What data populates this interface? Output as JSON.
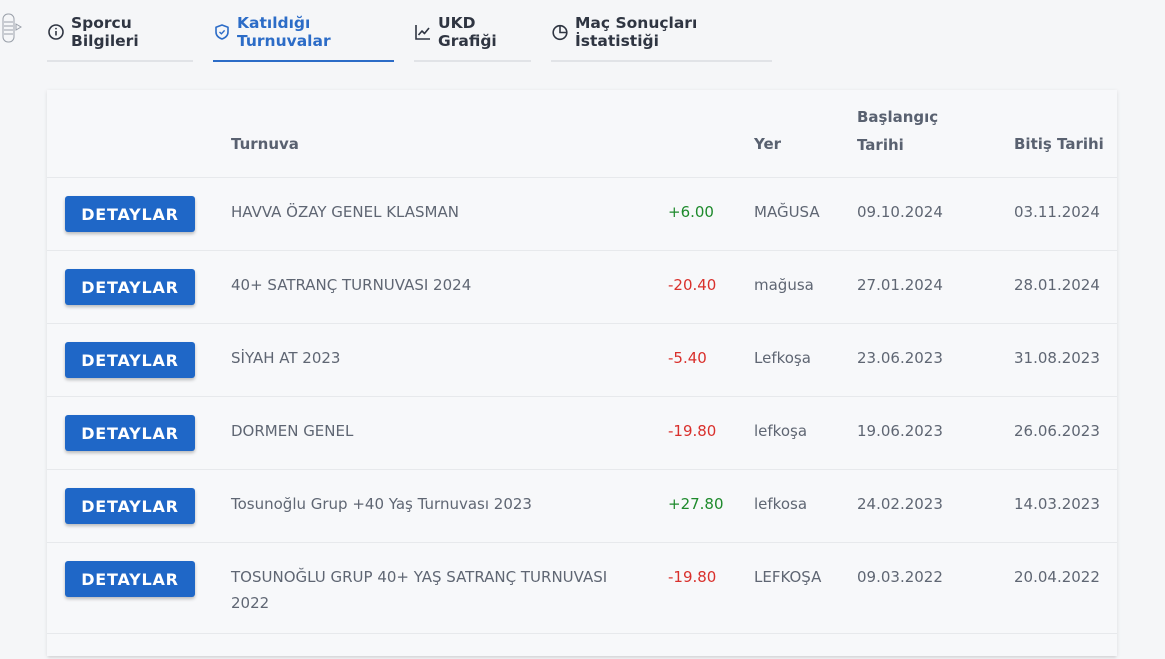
{
  "tabs": [
    {
      "label": "Sporcu Bilgileri",
      "icon": "info-circle-icon",
      "active": false
    },
    {
      "label": "Katıldığı Turnuvalar",
      "icon": "shield-icon",
      "active": true
    },
    {
      "label": "UKD Grafiği",
      "icon": "line-chart-icon",
      "active": false
    },
    {
      "label": "Maç Sonuçları İstatistiği",
      "icon": "pie-chart-icon",
      "active": false
    }
  ],
  "table": {
    "headers": {
      "turnuva": "Turnuva",
      "yer": "Yer",
      "baslangic_line1": "Başlangıç",
      "baslangic_line2": "Tarihi",
      "bitis": "Bitiş Tarihi"
    },
    "button_label": "DETAYLAR",
    "rows": [
      {
        "name": "HAVVA ÖZAY GENEL KLASMAN",
        "delta": "+6.00",
        "yer": "MAĞUSA",
        "baslangic": "09.10.2024",
        "bitis": "03.11.2024"
      },
      {
        "name": "40+ SATRANÇ TURNUVASI 2024",
        "delta": "-20.40",
        "yer": "mağusa",
        "baslangic": "27.01.2024",
        "bitis": "28.01.2024"
      },
      {
        "name": "SİYAH AT 2023",
        "delta": "-5.40",
        "yer": "Lefkoşa",
        "baslangic": "23.06.2023",
        "bitis": "31.08.2023"
      },
      {
        "name": "DORMEN GENEL",
        "delta": "-19.80",
        "yer": "lefkoşa",
        "baslangic": "19.06.2023",
        "bitis": "26.06.2023"
      },
      {
        "name": "Tosunoğlu Grup +40 Yaş Turnuvası 2023",
        "delta": "+27.80",
        "yer": "lefkosa",
        "baslangic": "24.02.2023",
        "bitis": "14.03.2023"
      },
      {
        "name_line1": "TOSUNOĞLU GRUP 40+ YAŞ SATRANÇ TURNUVASI",
        "name_line2": "2022",
        "delta": "-19.80",
        "yer": "LEFKOŞA",
        "baslangic": "09.03.2022",
        "bitis": "20.04.2022"
      }
    ]
  },
  "colors": {
    "accent": "#2c6cc7",
    "button": "#1f67c7",
    "positive": "#1e8a2c",
    "negative": "#d9302c"
  }
}
